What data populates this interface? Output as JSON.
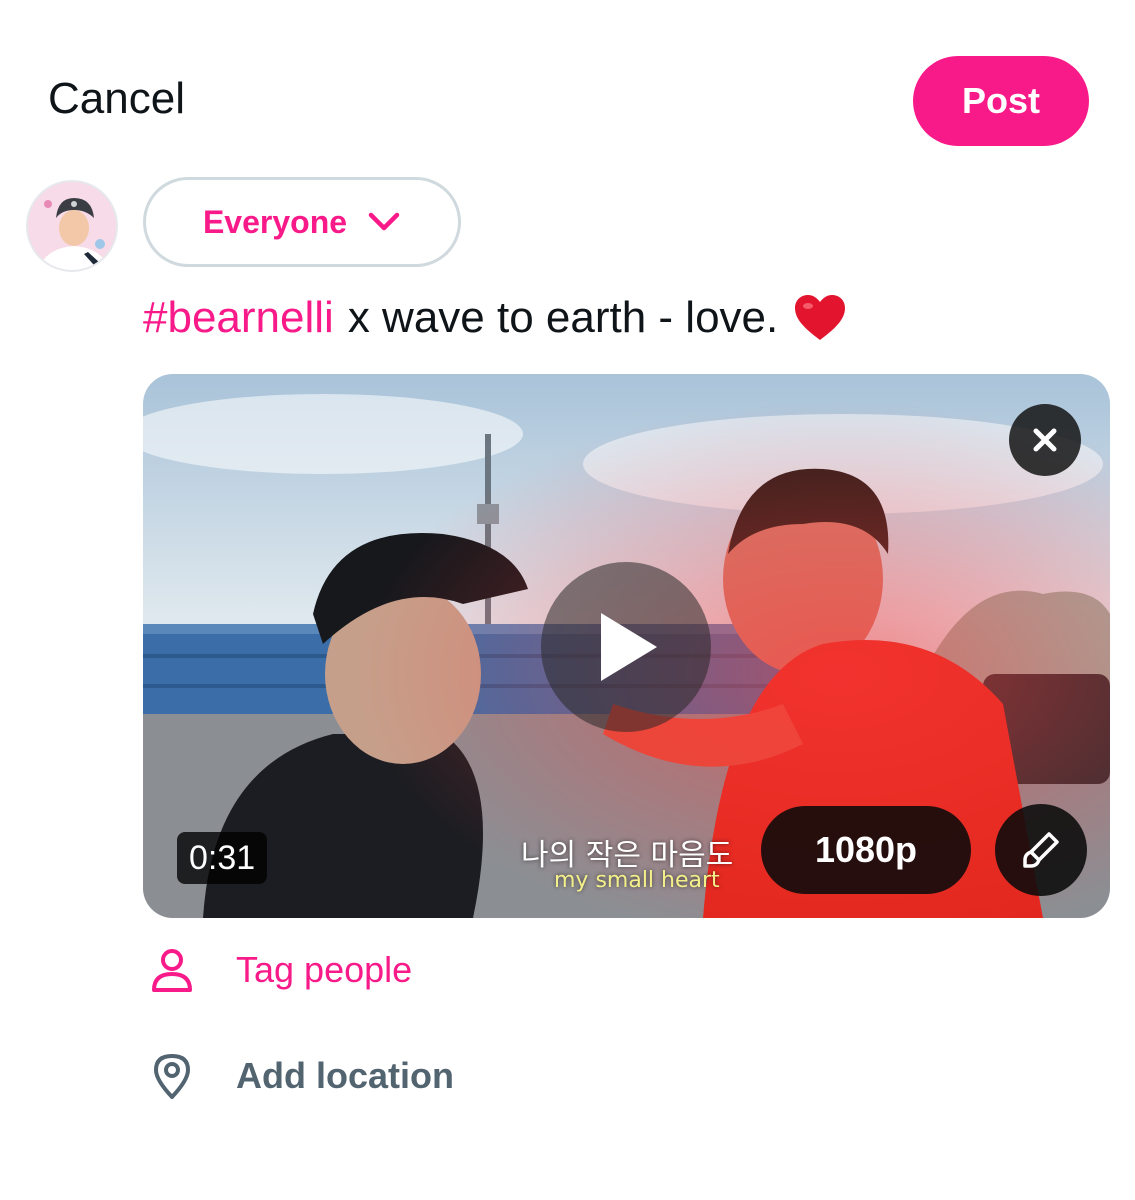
{
  "header": {
    "cancel_label": "Cancel",
    "post_label": "Post"
  },
  "composer": {
    "audience_label": "Everyone",
    "hashtag": "#bearnelli",
    "text": "x wave to earth - love.",
    "emoji": "red-heart"
  },
  "media": {
    "duration": "0:31",
    "quality_label": "1080p",
    "subtitle_korean": "나의 작은 마음도",
    "subtitle_english": "my small heart",
    "icons": {
      "remove": "close-icon",
      "play": "play-icon",
      "edit": "brush-icon"
    }
  },
  "actions": {
    "tag_people_label": "Tag people",
    "add_location_label": "Add location"
  },
  "colors": {
    "accent": "#f91a8a",
    "text": "#0f1419",
    "muted": "#536471",
    "border": "#cfd9de"
  }
}
